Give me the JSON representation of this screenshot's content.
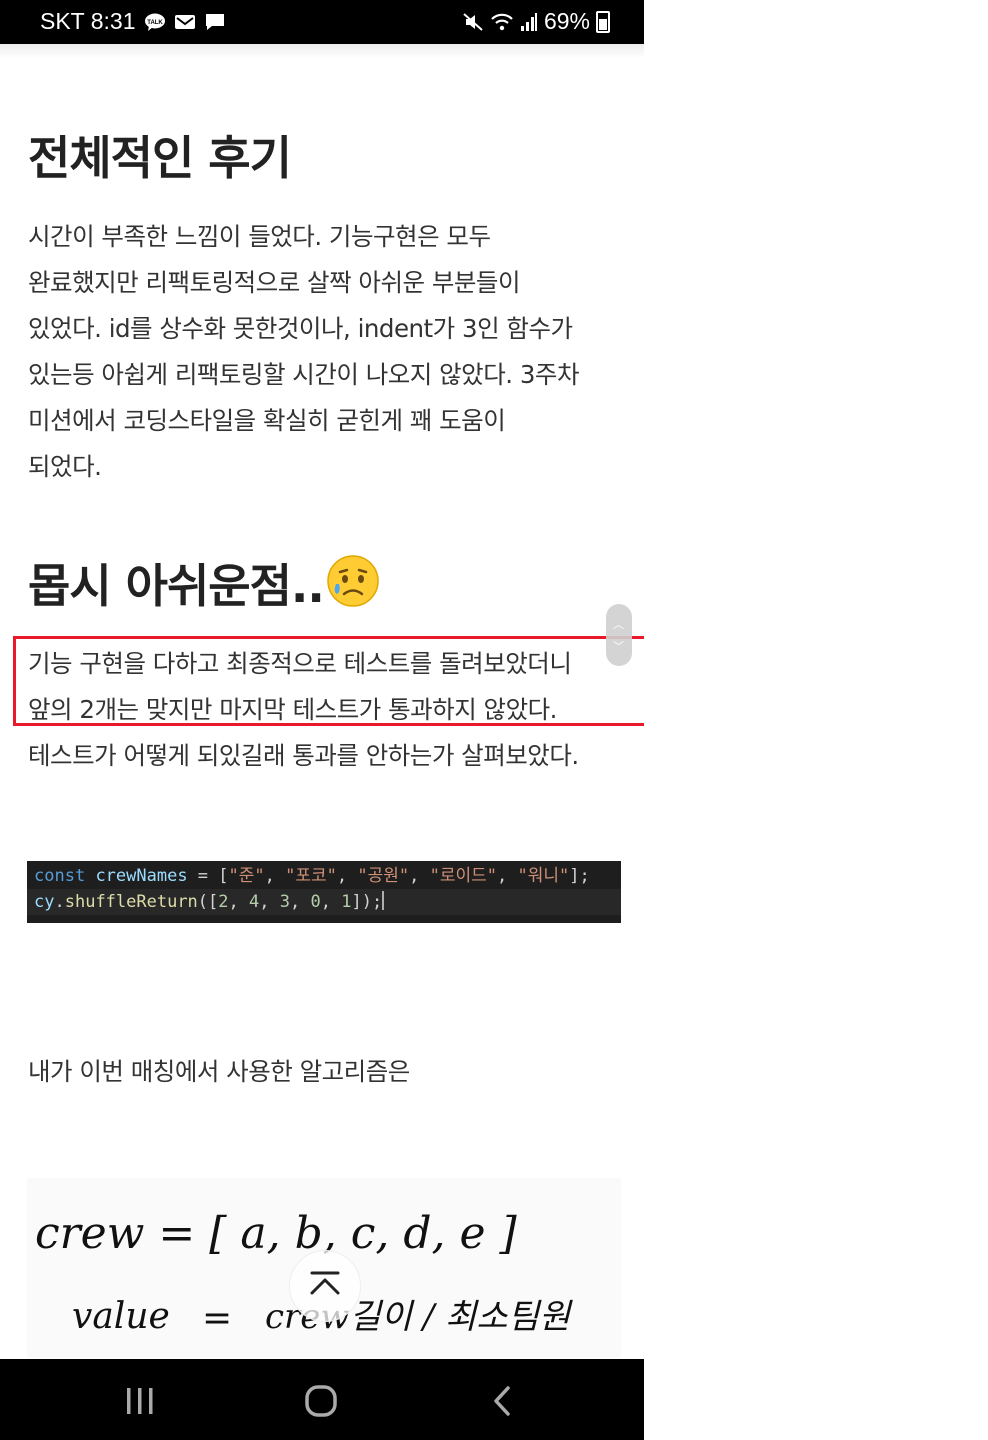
{
  "status_bar": {
    "carrier": "SKT",
    "time": "8:31",
    "notif_icons": [
      "talk-icon",
      "mail-icon",
      "message-icon"
    ],
    "system_icons": [
      "mute-icon",
      "wifi-icon",
      "signal-icon"
    ],
    "battery_percent": "69%"
  },
  "post": {
    "heading_review": "전체적인 후기",
    "review_lines": [
      "시간이 부족한 느낌이 들었다. 기능구현은 모두",
      "완료했지만 리팩토링적으로 살짝 아쉬운 부분들이",
      "있었다. id를 상수화 못한것이나, indent가 3인 함수가",
      "있는등 아쉽게 리팩토링할 시간이 나오지 않았다. 3주차",
      "미션에서 코딩스타일을 확실히 굳힌게 꽤 도움이",
      "되었다."
    ],
    "heading_regret": "몹시 아쉬운점..",
    "heading_regret_emoji": "sad-tear-face-icon",
    "regret_lines": [
      "기능 구현을 다하고 최종적으로 테스트를 돌려보았더니",
      "앞의 2개는 맞지만 마지막 테스트가 통과하지 않았다.",
      "테스트가 어떻게 되있길래 통과를 안하는가 살펴보았다."
    ],
    "code": {
      "line1": {
        "kw": "const",
        "id": "crewNames",
        "op": " = [",
        "items": [
          "\"준\"",
          "\"포코\"",
          "\"공원\"",
          "\"로이드\"",
          "\"워니\""
        ],
        "end": "];"
      },
      "line2": {
        "obj": "cy",
        "fn": "shuffleReturn",
        "nums": [
          "2",
          "4",
          "3",
          "0",
          "1"
        ]
      }
    },
    "algorithm_intro": "내가 이번 매칭에서 사용한 알고리즘은",
    "drawing": {
      "line1": "crew = [ a, b, c, d, e ]",
      "line2_left": "value",
      "line2_mid": "=",
      "line2_right": "crew길이 / 최소팀원"
    }
  },
  "highlight_color": "#e8192c",
  "nav_bar": {
    "recent_apps": "recent-apps-icon",
    "home": "home-icon",
    "back": "back-icon"
  }
}
